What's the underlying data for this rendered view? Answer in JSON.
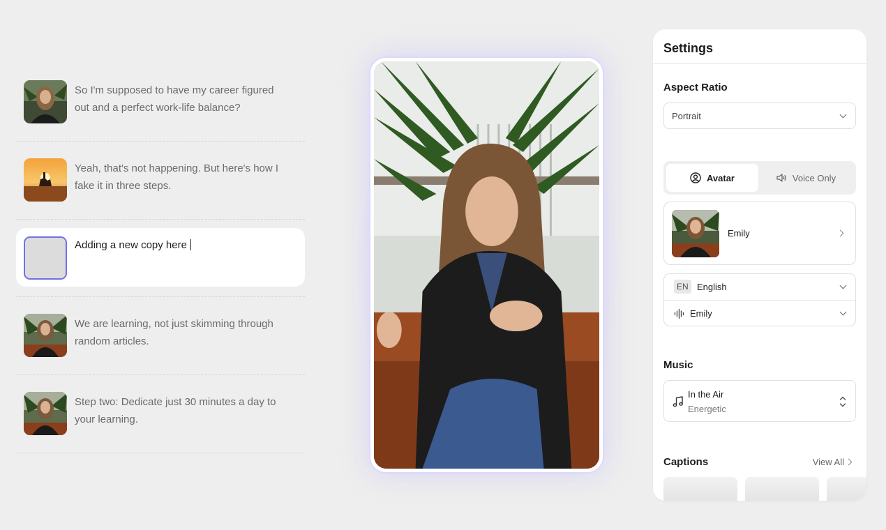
{
  "script": {
    "items": [
      {
        "text": "So I'm supposed to have my career figured out and a perfect work-life balance?",
        "thumb": "woman-portrait-thumbnail"
      },
      {
        "text": "Yeah, that's not happening. But here's how I fake it in three steps.",
        "thumb": "desert-sunset-rider-thumbnail"
      },
      {
        "text": "Adding a new copy here",
        "thumb": "empty-thumbnail",
        "active": true
      },
      {
        "text": "We are learning, not just skimming through random articles.",
        "thumb": "woman-speaking-thumbnail"
      },
      {
        "text": "Step two: Dedicate just 30 minutes a day to your learning.",
        "thumb": "woman-speaking-thumbnail"
      }
    ]
  },
  "preview": {
    "subject": "avatar-video-preview"
  },
  "settings": {
    "title": "Settings",
    "aspect_ratio": {
      "label": "Aspect Ratio",
      "value": "Portrait"
    },
    "mode": {
      "avatar_label": "Avatar",
      "voice_only_label": "Voice Only",
      "selected": "Avatar"
    },
    "avatar": {
      "name": "Emily"
    },
    "language": {
      "code": "EN",
      "name": "English"
    },
    "voice": {
      "name": "Emily"
    },
    "music": {
      "label": "Music",
      "track": "In the Air",
      "mood": "Energetic"
    },
    "captions": {
      "label": "Captions",
      "view_all": "View All"
    }
  },
  "colors": {
    "background": "#eeeeee",
    "accent": "#6f72e6",
    "panel": "#ffffff"
  }
}
